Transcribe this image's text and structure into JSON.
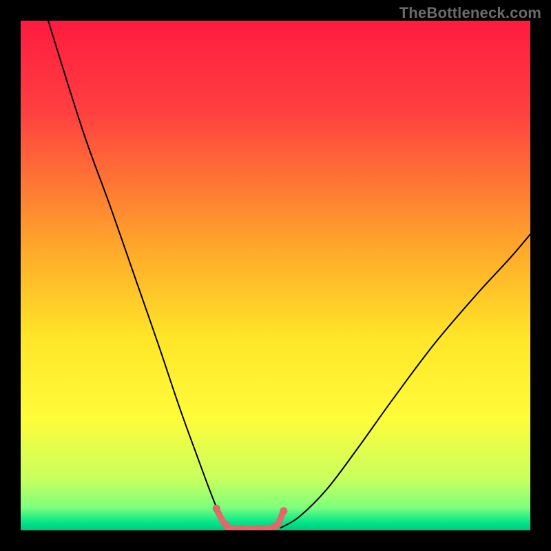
{
  "watermark": {
    "text": "TheBottleneck.com"
  },
  "chart_data": {
    "type": "line",
    "title": "",
    "xlabel": "",
    "ylabel": "",
    "xlim": [
      0,
      100
    ],
    "ylim": [
      0,
      100
    ],
    "grid": false,
    "legend": false,
    "background_gradient_stops": [
      {
        "offset": 0.0,
        "color": "#ff1b3f"
      },
      {
        "offset": 0.18,
        "color": "#ff4040"
      },
      {
        "offset": 0.45,
        "color": "#ffa92a"
      },
      {
        "offset": 0.62,
        "color": "#ffe528"
      },
      {
        "offset": 0.78,
        "color": "#fffc3a"
      },
      {
        "offset": 0.9,
        "color": "#c8ff5e"
      },
      {
        "offset": 0.955,
        "color": "#7dff7d"
      },
      {
        "offset": 0.985,
        "color": "#00e58a"
      },
      {
        "offset": 1.0,
        "color": "#00c77e"
      }
    ],
    "series": [
      {
        "name": "left-curve",
        "stroke": "#000000",
        "stroke_width": 2.0,
        "x": [
          5.4,
          12.2,
          17.6,
          22.3,
          27.0,
          31.1,
          34.5,
          37.2,
          39.2,
          40.5
        ],
        "y": [
          100.0,
          78.4,
          63.5,
          50.0,
          36.5,
          24.3,
          14.9,
          7.6,
          2.7,
          0.5
        ]
      },
      {
        "name": "right-curve",
        "stroke": "#000000",
        "stroke_width": 2.0,
        "x": [
          51.0,
          54.7,
          60.1,
          66.2,
          73.0,
          81.1,
          89.2,
          96.0,
          100.0
        ],
        "y": [
          0.5,
          2.7,
          8.1,
          16.2,
          25.7,
          36.5,
          46.0,
          53.4,
          58.1
        ]
      },
      {
        "name": "valley-highlight",
        "stroke": "#e16a6a",
        "stroke_width": 9.0,
        "x": [
          38.5,
          40.5,
          43.2,
          47.3,
          50.0,
          51.4
        ],
        "y": [
          4.0,
          0.7,
          0.3,
          0.3,
          0.7,
          3.4
        ]
      }
    ],
    "markers": [
      {
        "name": "valley-dots",
        "fill": "#e06868",
        "radius": 5.5,
        "points": [
          {
            "x": 38.4,
            "y": 4.3
          },
          {
            "x": 40.3,
            "y": 1.1
          },
          {
            "x": 43.2,
            "y": 0.3
          },
          {
            "x": 47.0,
            "y": 0.3
          },
          {
            "x": 49.7,
            "y": 0.8
          },
          {
            "x": 51.6,
            "y": 3.8
          }
        ]
      }
    ]
  }
}
